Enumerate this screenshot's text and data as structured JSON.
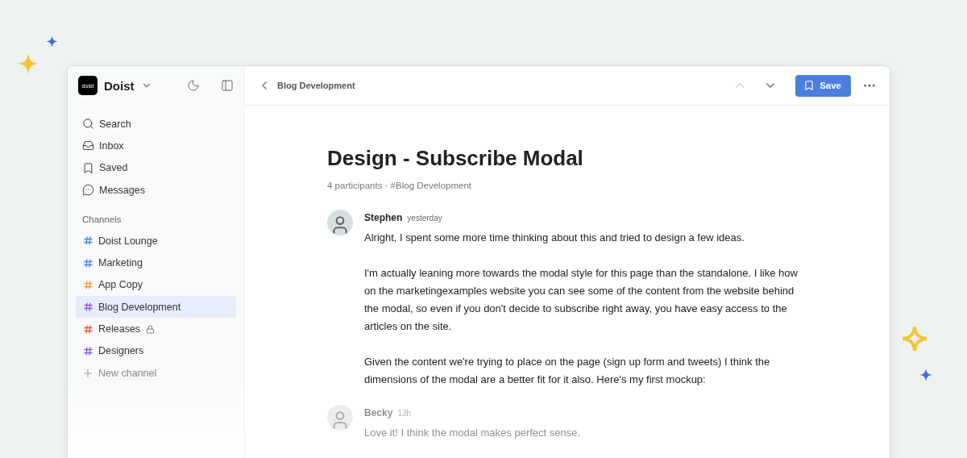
{
  "workspace": {
    "name": "Doist",
    "logo": "doist"
  },
  "nav": [
    {
      "kind": "search",
      "label": "Search"
    },
    {
      "kind": "inbox",
      "label": "Inbox"
    },
    {
      "kind": "saved",
      "label": "Saved"
    },
    {
      "kind": "messages",
      "label": "Messages"
    }
  ],
  "channels_heading": "Channels",
  "channels": [
    {
      "name": "Doist Lounge",
      "color": "#4a7fe8",
      "selected": false,
      "locked": false
    },
    {
      "name": "Marketing",
      "color": "#4a7fe8",
      "selected": false,
      "locked": false
    },
    {
      "name": "App Copy",
      "color": "#f09a3a",
      "selected": false,
      "locked": false
    },
    {
      "name": "Blog Development",
      "color": "#8a55d9",
      "selected": true,
      "locked": false
    },
    {
      "name": "Releases",
      "color": "#e5534b",
      "selected": false,
      "locked": true
    },
    {
      "name": "Designers",
      "color": "#8a55d9",
      "selected": false,
      "locked": false
    }
  ],
  "new_channel": "New channel",
  "header": {
    "back_label": "Blog Development",
    "save_label": "Save"
  },
  "thread": {
    "title": "Design - Subscribe Modal",
    "meta": "4 participants · #Blog Development"
  },
  "messages": [
    {
      "author": "Stephen",
      "time": "yesterday",
      "faded": false,
      "paragraphs": [
        "Alright, I spent some more time thinking about this and tried to design a few ideas.",
        "I'm actually leaning more towards the modal style for this page than the standalone. I like how on the marketingexamples website you can see some of the content from the website behind the modal, so even if you don't decide to subscribe right away, you have easy access to the articles on the site.",
        "Given the content we're trying to place on the page (sign up form and tweets) I think the dimensions of the modal are a better fit for it also. Here's my first mockup:"
      ]
    },
    {
      "author": "Becky",
      "time": "13h",
      "faded": true,
      "paragraphs": [
        "Love it! I think the modal makes perfect sense."
      ]
    }
  ]
}
